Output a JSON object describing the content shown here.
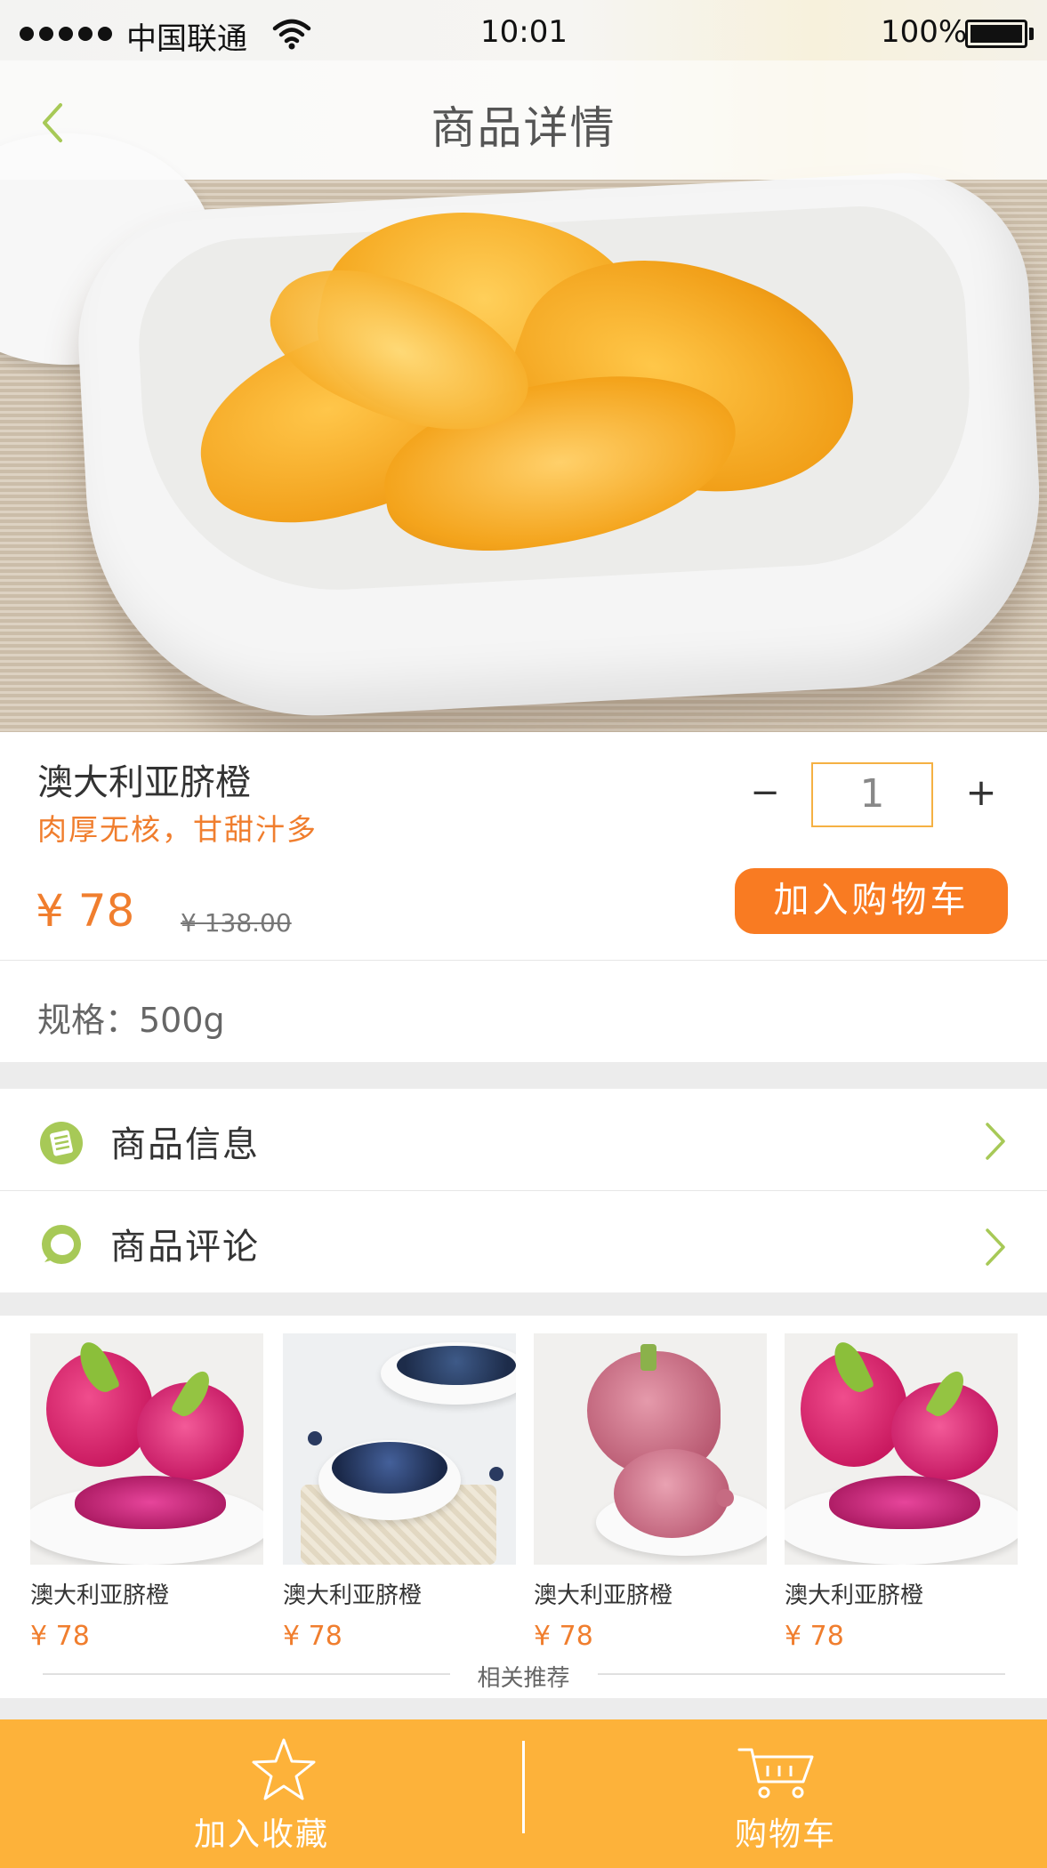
{
  "status_bar": {
    "carrier": "中国联通",
    "time": "10:01",
    "battery": "100%"
  },
  "nav": {
    "title": "商品详情"
  },
  "product": {
    "name": "澳大利亚脐橙",
    "description": "肉厚无核，甘甜汁多",
    "price": "¥ 78",
    "original_price": "¥ 138.00",
    "quantity": "1",
    "add_to_cart_label": "加入购物车",
    "spec": "规格：500g"
  },
  "menu": {
    "info_label": "商品信息",
    "reviews_label": "商品评论"
  },
  "recommend": {
    "title": "相关推荐",
    "items": [
      {
        "name": "澳大利亚脐橙",
        "price": "¥ 78",
        "image": "dragon-fruit"
      },
      {
        "name": "澳大利亚脐橙",
        "price": "¥ 78",
        "image": "blueberries"
      },
      {
        "name": "澳大利亚脐橙",
        "price": "¥ 78",
        "image": "grapes"
      },
      {
        "name": "澳大利亚脐橙",
        "price": "¥ 78",
        "image": "dragon-fruit"
      }
    ]
  },
  "bottom_bar": {
    "favorite_label": "加入收藏",
    "cart_label": "购物车"
  },
  "colors": {
    "accent_orange": "#f97b22",
    "price_orange": "#f07e2e",
    "bottom_bar": "#fdb23a",
    "icon_green": "#a7c957",
    "qty_border": "#f5b143"
  }
}
